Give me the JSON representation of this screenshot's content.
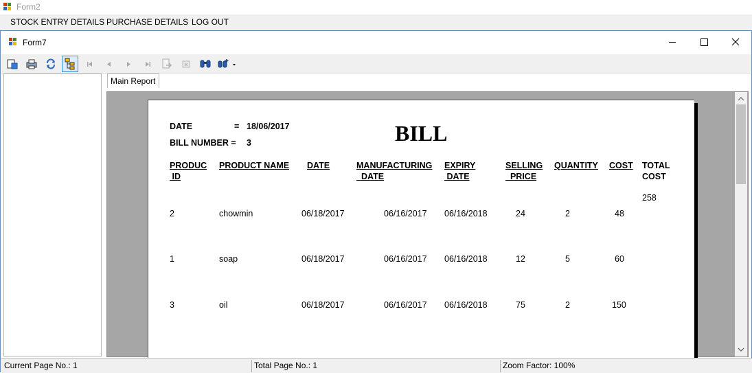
{
  "outer_window": {
    "title": "Form2"
  },
  "menu": {
    "items": [
      "STOCK ENTRY DETAILS",
      "PURCHASE DETAILS",
      "LOG OUT"
    ]
  },
  "inner_window": {
    "title": "Form7"
  },
  "tab": {
    "label": "Main Report"
  },
  "report": {
    "date_label": "DATE",
    "date_eq": "=",
    "date_value": "18/06/2017",
    "bill_number_label": "BILL NUMBER =",
    "bill_number_value": "3",
    "title": "BILL",
    "headers": [
      [
        "PRODUC",
        "ID"
      ],
      [
        "PRODUCT NAME",
        ""
      ],
      [
        "DATE",
        ""
      ],
      [
        "MANUFACTURING",
        "_DATE"
      ],
      [
        "EXPIRY",
        "DATE"
      ],
      [
        "SELLING",
        "_PRICE"
      ],
      [
        "QUANTITY",
        ""
      ],
      [
        "COST",
        ""
      ],
      [
        "TOTAL",
        "COST"
      ]
    ],
    "total_cost": "258",
    "rows": [
      [
        "2",
        "chowmin",
        "06/18/2017",
        "06/16/2017",
        "06/16/2018",
        "24",
        "2",
        "48"
      ],
      [
        "1",
        "soap",
        "06/18/2017",
        "06/16/2017",
        "06/16/2018",
        "12",
        "5",
        "60"
      ],
      [
        "3",
        "oil",
        "06/18/2017",
        "06/16/2017",
        "06/16/2018",
        "75",
        "2",
        "150"
      ]
    ]
  },
  "status": {
    "current_page": "Current Page No.: 1",
    "total_page": "Total Page No.: 1",
    "zoom": "Zoom Factor: 100%"
  }
}
